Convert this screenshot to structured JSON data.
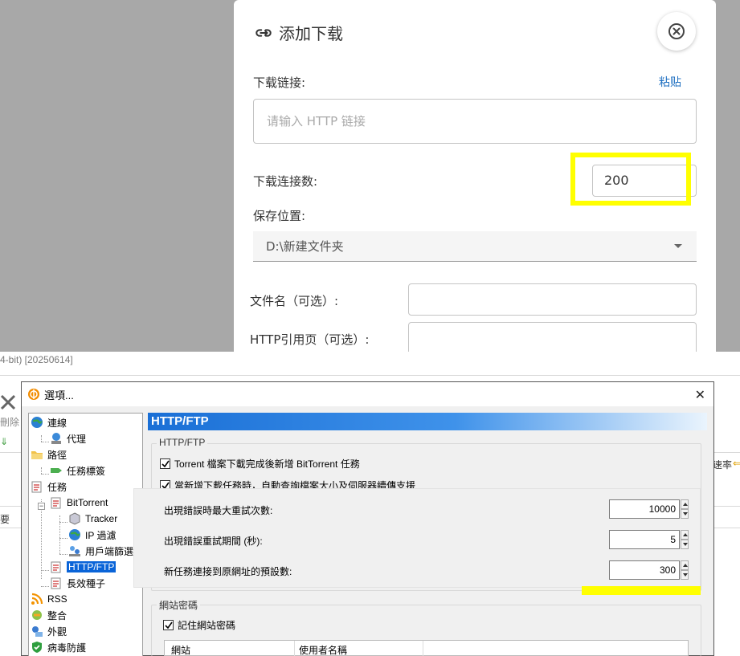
{
  "add_download": {
    "title": "添加下载",
    "icon": "link-icon",
    "close_icon": "close-circle-icon",
    "url_label": "下载链接:",
    "paste_label": "粘贴",
    "url_placeholder": "请输入 HTTP 链接",
    "url_value": "",
    "connections_label": "下载连接数:",
    "connections_value": "200",
    "save_location_label": "保存位置:",
    "save_location_value": "D:\\新建文件夹",
    "filename_label": "文件名（可选）:",
    "filename_value": "",
    "referer_label": "HTTP引用页（可选）:",
    "referer_value": "",
    "highlight_color": "#ffff00"
  },
  "background_app": {
    "title_fragment": "4-bit) [20250614]",
    "delete_label": "刪除",
    "column_left": "要",
    "column_right": "速率"
  },
  "options_dialog": {
    "title": "選項...",
    "close_glyph": "✕",
    "tree": [
      {
        "label": "連線",
        "icon": "globe-icon"
      },
      {
        "label": "代理",
        "icon": "network-icon"
      },
      {
        "label": "路徑",
        "icon": "folder-icon"
      },
      {
        "label": "任務標簽",
        "icon": "tag-icon"
      },
      {
        "label": "任務",
        "icon": "task-icon"
      },
      {
        "label": "BitTorrent",
        "icon": "task-icon"
      },
      {
        "label": "Tracker",
        "icon": "cube-icon"
      },
      {
        "label": "IP 過濾",
        "icon": "globe-icon"
      },
      {
        "label": "用戶端篩選",
        "icon": "users-icon"
      },
      {
        "label": "HTTP/FTP",
        "icon": "task-icon",
        "selected": true
      },
      {
        "label": "長效種子",
        "icon": "task-icon"
      },
      {
        "label": "RSS",
        "icon": "rss-icon"
      },
      {
        "label": "整合",
        "icon": "integrate-icon"
      },
      {
        "label": "外觀",
        "icon": "appearance-icon"
      },
      {
        "label": "病毒防護",
        "icon": "shield-icon"
      }
    ],
    "panel_title": "HTTP/FTP",
    "http_group": {
      "title": "HTTP/FTP",
      "checkbox1": "Torrent 檔案下載完成後新增 BitTorrent 任務",
      "checkbox1_checked": true,
      "checkbox2": "當新增下載任務時，自動查詢檔案大小及伺服器續傳支援",
      "checkbox2_checked": true,
      "max_retries_label": "出現錯誤時最大重試次數:",
      "max_retries_value": "10000",
      "retry_interval_label": "出現錯誤重試期間 (秒):",
      "retry_interval_value": "5",
      "default_connections_label": "新任務連接到原網址的預設數:",
      "default_connections_value": "300"
    },
    "password_group": {
      "title": "網站密碼",
      "remember_label": "記住網站密碼",
      "remember_checked": true,
      "col_site": "網站",
      "col_username": "使用者名稱"
    }
  }
}
